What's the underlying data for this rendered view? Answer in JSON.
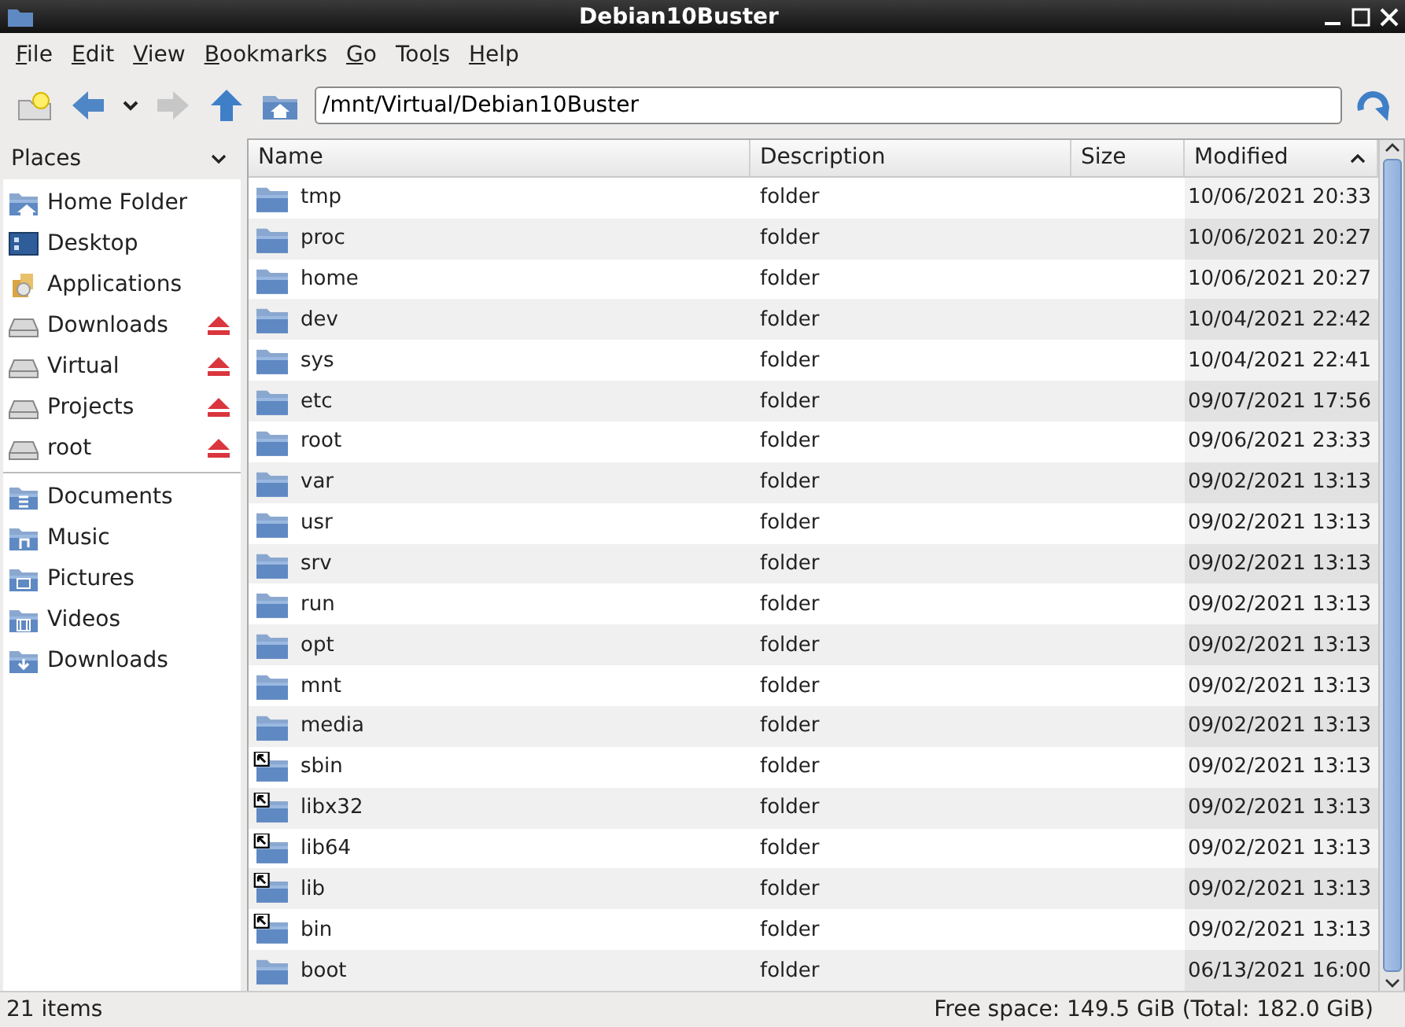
{
  "window": {
    "title": "Debian10Buster"
  },
  "menu": [
    {
      "access_key": "F",
      "rest": "ile"
    },
    {
      "access_key": "E",
      "rest": "dit"
    },
    {
      "access_key": "V",
      "rest": "iew"
    },
    {
      "access_key": "B",
      "rest": "ookmarks"
    },
    {
      "access_key": "G",
      "rest": "o"
    },
    {
      "before": "Too",
      "access_key": "l",
      "rest": "s"
    },
    {
      "access_key": "H",
      "rest": "elp"
    }
  ],
  "toolbar": {
    "back_enabled": true,
    "forward_enabled": false,
    "location": "/mnt/Virtual/Debian10Buster"
  },
  "sidebar": {
    "title": "Places",
    "sections": [
      [
        {
          "label": "Home Folder",
          "kind": "home",
          "ejectable": false
        },
        {
          "label": "Desktop",
          "kind": "desktop",
          "ejectable": false
        },
        {
          "label": "Applications",
          "kind": "apps",
          "ejectable": false
        },
        {
          "label": "Downloads",
          "kind": "drive",
          "ejectable": true
        },
        {
          "label": "Virtual",
          "kind": "drive",
          "ejectable": true
        },
        {
          "label": "Projects",
          "kind": "drive",
          "ejectable": true
        },
        {
          "label": "root",
          "kind": "drive",
          "ejectable": true
        }
      ],
      [
        {
          "label": "Documents",
          "kind": "documents",
          "ejectable": false
        },
        {
          "label": "Music",
          "kind": "music",
          "ejectable": false
        },
        {
          "label": "Pictures",
          "kind": "pictures",
          "ejectable": false
        },
        {
          "label": "Videos",
          "kind": "videos",
          "ejectable": false
        },
        {
          "label": "Downloads",
          "kind": "downloads",
          "ejectable": false
        }
      ]
    ]
  },
  "table": {
    "columns": [
      {
        "label": "Name",
        "sorted": false
      },
      {
        "label": "Description",
        "sorted": false
      },
      {
        "label": "Size",
        "sorted": false
      },
      {
        "label": "Modified",
        "sorted": true
      }
    ],
    "rows": [
      {
        "name": "tmp",
        "description": "folder",
        "modified": "10/06/2021 20:33",
        "symlink": false
      },
      {
        "name": "proc",
        "description": "folder",
        "modified": "10/06/2021 20:27",
        "symlink": false
      },
      {
        "name": "home",
        "description": "folder",
        "modified": "10/06/2021 20:27",
        "symlink": false
      },
      {
        "name": "dev",
        "description": "folder",
        "modified": "10/04/2021 22:42",
        "symlink": false
      },
      {
        "name": "sys",
        "description": "folder",
        "modified": "10/04/2021 22:41",
        "symlink": false
      },
      {
        "name": "etc",
        "description": "folder",
        "modified": "09/07/2021 17:56",
        "symlink": false
      },
      {
        "name": "root",
        "description": "folder",
        "modified": "09/06/2021 23:33",
        "symlink": false
      },
      {
        "name": "var",
        "description": "folder",
        "modified": "09/02/2021 13:13",
        "symlink": false
      },
      {
        "name": "usr",
        "description": "folder",
        "modified": "09/02/2021 13:13",
        "symlink": false
      },
      {
        "name": "srv",
        "description": "folder",
        "modified": "09/02/2021 13:13",
        "symlink": false
      },
      {
        "name": "run",
        "description": "folder",
        "modified": "09/02/2021 13:13",
        "symlink": false
      },
      {
        "name": "opt",
        "description": "folder",
        "modified": "09/02/2021 13:13",
        "symlink": false
      },
      {
        "name": "mnt",
        "description": "folder",
        "modified": "09/02/2021 13:13",
        "symlink": false
      },
      {
        "name": "media",
        "description": "folder",
        "modified": "09/02/2021 13:13",
        "symlink": false
      },
      {
        "name": "sbin",
        "description": "folder",
        "modified": "09/02/2021 13:13",
        "symlink": true
      },
      {
        "name": "libx32",
        "description": "folder",
        "modified": "09/02/2021 13:13",
        "symlink": true
      },
      {
        "name": "lib64",
        "description": "folder",
        "modified": "09/02/2021 13:13",
        "symlink": true
      },
      {
        "name": "lib",
        "description": "folder",
        "modified": "09/02/2021 13:13",
        "symlink": true
      },
      {
        "name": "bin",
        "description": "folder",
        "modified": "09/02/2021 13:13",
        "symlink": true
      },
      {
        "name": "boot",
        "description": "folder",
        "modified": "06/13/2021 16:00",
        "symlink": false
      }
    ]
  },
  "status_bar": {
    "items": "21 items",
    "free_space": "Free space: 149.5 GiB (Total: 182.0 GiB)"
  }
}
